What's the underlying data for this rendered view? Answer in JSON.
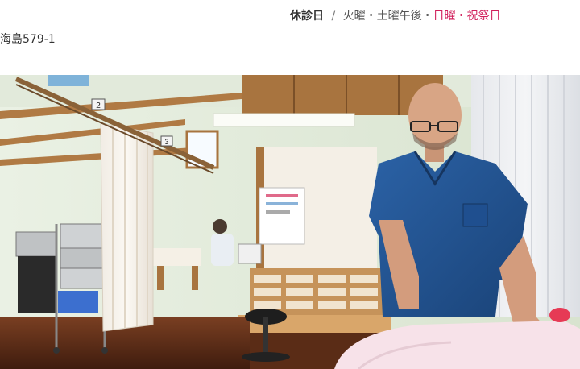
{
  "header": {
    "holiday_label": "休診日",
    "separator": "/",
    "days_gray": "火曜・土曜午後・",
    "days_red": "日曜・祝祭日",
    "address_partial": "海島579-1"
  },
  "photo": {
    "rail_labels": [
      "2",
      "3"
    ],
    "colors": {
      "accent_red": "#d11f5b",
      "scrub_blue": "#1f4f8f"
    }
  }
}
